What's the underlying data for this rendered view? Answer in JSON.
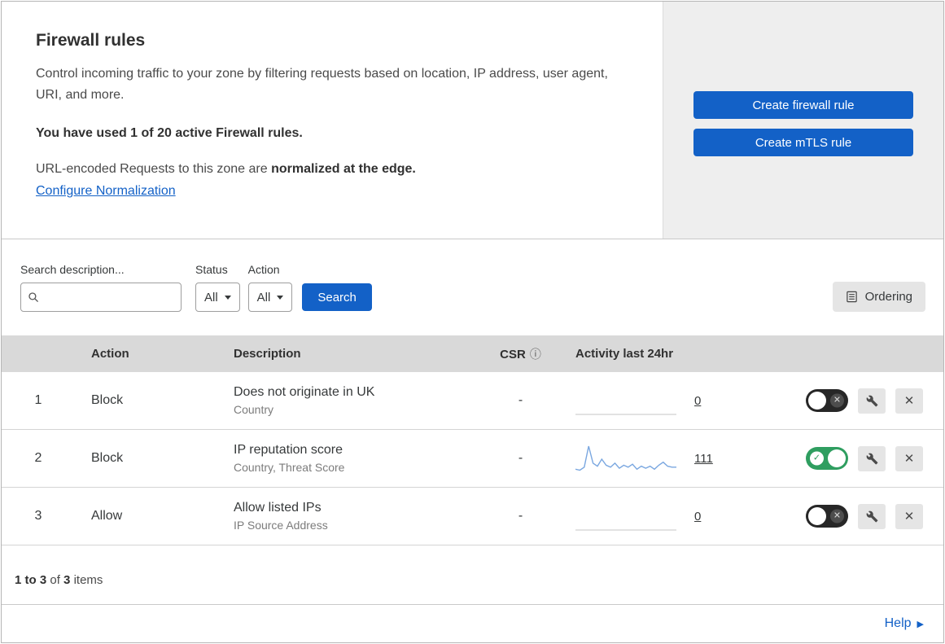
{
  "colors": {
    "accent": "#1361c7",
    "toggle_on": "#2f9e60",
    "spark_blue": "#7aa7e0",
    "spark_flat": "#d8d8d8",
    "table_header_bg": "#d9d9d9"
  },
  "icons": {
    "info": "ⓘ",
    "help_arrow": "▶",
    "delete_glyph": "✕",
    "toggle_on_glyph": "✓",
    "toggle_off_glyph": "✕"
  },
  "header": {
    "title": "Firewall rules",
    "description": "Control incoming traffic to your zone by filtering requests based on location, IP address, user agent, URI, and more.",
    "usage_text": "You have used 1 of 20 active Firewall rules.",
    "normalization_prefix": "URL-encoded Requests to this zone are ",
    "normalization_bold": "normalized at the edge.",
    "normalization_link": "Configure Normalization",
    "create_firewall_button": "Create firewall rule",
    "create_mtls_button": "Create mTLS rule"
  },
  "filters": {
    "search_label": "Search description...",
    "status_label": "Status",
    "status_value": "All",
    "action_label": "Action",
    "action_value": "All",
    "search_button": "Search",
    "ordering_button": "Ordering"
  },
  "table": {
    "headers": {
      "action": "Action",
      "description": "Description",
      "csr": "CSR",
      "activity": "Activity last 24hr"
    },
    "rows": [
      {
        "priority": "1",
        "action": "Block",
        "description": "Does not originate in UK",
        "fields": "Country",
        "csr": "-",
        "activity": "0",
        "enabled": false,
        "spark_color": "#d8d8d8",
        "sparkline": [
          0,
          0,
          0,
          0,
          0,
          0,
          0,
          0,
          0,
          0,
          0,
          0,
          0,
          0,
          0,
          0,
          0,
          0,
          0,
          0,
          0,
          0,
          0,
          0
        ]
      },
      {
        "priority": "2",
        "action": "Block",
        "description": "IP reputation score",
        "fields": "Country, Threat Score",
        "csr": "-",
        "activity": "111",
        "enabled": true,
        "spark_color": "#7aa7e0",
        "sparkline": [
          3,
          2,
          5,
          26,
          9,
          6,
          13,
          7,
          5,
          9,
          4,
          7,
          5,
          8,
          3,
          6,
          4,
          6,
          3,
          7,
          10,
          6,
          5,
          5
        ]
      },
      {
        "priority": "3",
        "action": "Allow",
        "description": "Allow listed IPs",
        "fields": "IP Source Address",
        "csr": "-",
        "activity": "0",
        "enabled": false,
        "spark_color": "#d8d8d8",
        "sparkline": [
          0,
          0,
          0,
          0,
          0,
          0,
          0,
          0,
          0,
          0,
          0,
          0,
          0,
          0,
          0,
          0,
          0,
          0,
          0,
          0,
          0,
          0,
          0,
          0
        ]
      }
    ]
  },
  "footer": {
    "range": "1 to 3",
    "of_word": "of",
    "total": "3",
    "items_word": "items"
  },
  "help": {
    "label": "Help"
  }
}
